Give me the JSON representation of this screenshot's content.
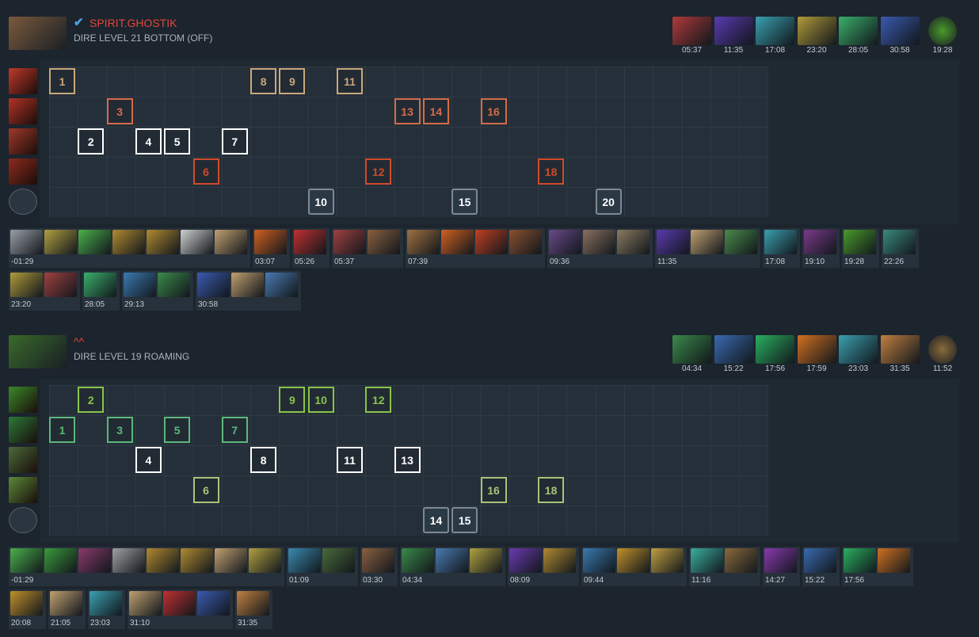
{
  "players": [
    {
      "verified": true,
      "name": "SPIRIT.GHOSTIK",
      "name_color": "#e0473a",
      "subtitle": "DIRE LEVEL 21 BOTTOM (OFF)",
      "portrait_color": "#7a5a3c",
      "final_items": [
        {
          "time": "05:37",
          "color": "#b03a3a"
        },
        {
          "time": "11:35",
          "color": "#5a3ab0"
        },
        {
          "time": "17:08",
          "color": "#3aa0b0"
        },
        {
          "time": "23:20",
          "color": "#b09a3a"
        },
        {
          "time": "28:05",
          "color": "#3ab06a"
        },
        {
          "time": "30:58",
          "color": "#3a5ab0"
        }
      ],
      "neutral": {
        "time": "19:28",
        "color": "#4a9a2a"
      },
      "skills": [
        {
          "name": "skill-1-icon",
          "color": "#c0392b",
          "row_color": "#c9a77a"
        },
        {
          "name": "skill-2-icon",
          "color": "#b33326",
          "row_color": "#d46b4a"
        },
        {
          "name": "skill-3-icon",
          "color": "#a0392b",
          "row_color": "#ffffff"
        },
        {
          "name": "skill-4-icon",
          "color": "#8e2b1e",
          "row_color": "#d04a2a"
        },
        {
          "name": "talent-icon",
          "color": "#2b3540",
          "row_color": "#7d8993"
        }
      ],
      "levels": [
        {
          "lv": "1",
          "row": 0,
          "col": 0
        },
        {
          "lv": "2",
          "row": 2,
          "col": 1
        },
        {
          "lv": "3",
          "row": 1,
          "col": 2
        },
        {
          "lv": "4",
          "row": 2,
          "col": 3
        },
        {
          "lv": "5",
          "row": 2,
          "col": 4
        },
        {
          "lv": "6",
          "row": 3,
          "col": 5
        },
        {
          "lv": "7",
          "row": 2,
          "col": 6
        },
        {
          "lv": "8",
          "row": 0,
          "col": 7
        },
        {
          "lv": "9",
          "row": 0,
          "col": 8
        },
        {
          "lv": "10",
          "row": 4,
          "col": 9
        },
        {
          "lv": "11",
          "row": 0,
          "col": 10
        },
        {
          "lv": "12",
          "row": 3,
          "col": 11
        },
        {
          "lv": "13",
          "row": 1,
          "col": 12
        },
        {
          "lv": "14",
          "row": 1,
          "col": 13
        },
        {
          "lv": "15",
          "row": 4,
          "col": 14
        },
        {
          "lv": "16",
          "row": 1,
          "col": 15
        },
        {
          "lv": "18",
          "row": 3,
          "col": 17
        },
        {
          "lv": "20",
          "row": 4,
          "col": 19
        }
      ],
      "timeline_rows": [
        [
          {
            "time": "-01:29",
            "icons": [
              "#9aa0a6",
              "#b0a040",
              "#4ab04a",
              "#b08a30",
              "#b08a30",
              "#d0d0d0",
              "#c0a070"
            ]
          },
          {
            "time": "03:07",
            "icons": [
              "#d06020"
            ]
          },
          {
            "time": "05:26",
            "icons": [
              "#c03030"
            ]
          },
          {
            "time": "05:37",
            "icons": [
              "#a04040",
              "#8a6040"
            ]
          },
          {
            "time": "07:39",
            "icons": [
              "#a07040",
              "#d06020",
              "#c04020",
              "#8a5030"
            ]
          },
          {
            "time": "09:36",
            "icons": [
              "#6a4a8a",
              "#8a7060",
              "#8a7a60"
            ]
          },
          {
            "time": "11:35",
            "icons": [
              "#5a3ab0",
              "#c0a070",
              "#4a8a4a"
            ]
          },
          {
            "time": "17:08",
            "icons": [
              "#3aa0b0"
            ]
          },
          {
            "time": "19:10",
            "icons": [
              "#7a3a8a"
            ]
          },
          {
            "time": "19:28",
            "icons": [
              "#4a9a2a"
            ]
          },
          {
            "time": "22:26",
            "icons": [
              "#3a8a7a"
            ]
          }
        ],
        [
          {
            "time": "23:20",
            "icons": [
              "#b09a3a",
              "#a04040"
            ]
          },
          {
            "time": "28:05",
            "icons": [
              "#3ab06a"
            ]
          },
          {
            "time": "29:13",
            "icons": [
              "#3a7ab0",
              "#3a8a4a"
            ]
          },
          {
            "time": "30:58",
            "icons": [
              "#3a5ab0",
              "#c0a070",
              "#4a7ab0"
            ]
          }
        ]
      ]
    },
    {
      "verified": false,
      "name": "^^",
      "name_color": "#e0473a",
      "subtitle": "DIRE LEVEL 19 ROAMING",
      "portrait_color": "#3a6a2a",
      "final_items": [
        {
          "time": "04:34",
          "color": "#3a8a4a"
        },
        {
          "time": "15:22",
          "color": "#3a6ab0"
        },
        {
          "time": "17:56",
          "color": "#2ab060"
        },
        {
          "time": "17:59",
          "color": "#d07020"
        },
        {
          "time": "23:03",
          "color": "#3aa0b0"
        },
        {
          "time": "31:35",
          "color": "#c08040"
        }
      ],
      "neutral": {
        "time": "11:52",
        "color": "#8a6a3a"
      },
      "skills": [
        {
          "name": "skill-1-icon",
          "color": "#3a8a2a",
          "row_color": "#8ac34a"
        },
        {
          "name": "skill-2-icon",
          "color": "#2a7a3a",
          "row_color": "#5ab87a"
        },
        {
          "name": "skill-3-icon",
          "color": "#4a6a3a",
          "row_color": "#ffffff"
        },
        {
          "name": "skill-4-icon",
          "color": "#5a8a3a",
          "row_color": "#a8c37a"
        },
        {
          "name": "talent-icon",
          "color": "#2b3540",
          "row_color": "#7d8993"
        }
      ],
      "levels": [
        {
          "lv": "1",
          "row": 1,
          "col": 0
        },
        {
          "lv": "2",
          "row": 0,
          "col": 1
        },
        {
          "lv": "3",
          "row": 1,
          "col": 2
        },
        {
          "lv": "4",
          "row": 2,
          "col": 3
        },
        {
          "lv": "5",
          "row": 1,
          "col": 4
        },
        {
          "lv": "6",
          "row": 3,
          "col": 5
        },
        {
          "lv": "7",
          "row": 1,
          "col": 6
        },
        {
          "lv": "8",
          "row": 2,
          "col": 7
        },
        {
          "lv": "9",
          "row": 0,
          "col": 8
        },
        {
          "lv": "10",
          "row": 0,
          "col": 9
        },
        {
          "lv": "11",
          "row": 2,
          "col": 10
        },
        {
          "lv": "12",
          "row": 0,
          "col": 11
        },
        {
          "lv": "13",
          "row": 2,
          "col": 12
        },
        {
          "lv": "14",
          "row": 4,
          "col": 13
        },
        {
          "lv": "15",
          "row": 4,
          "col": 14
        },
        {
          "lv": "16",
          "row": 3,
          "col": 15
        },
        {
          "lv": "18",
          "row": 3,
          "col": 17
        }
      ],
      "timeline_rows": [
        [
          {
            "time": "-01:29",
            "icons": [
              "#4ab04a",
              "#3a9a3a",
              "#8a3a6a",
              "#a0a0a0",
              "#b08a30",
              "#b08a30",
              "#c0a070",
              "#b0a040"
            ]
          },
          {
            "time": "01:09",
            "icons": [
              "#3a8ab0",
              "#4a6a3a"
            ]
          },
          {
            "time": "03:30",
            "icons": [
              "#8a6040"
            ]
          },
          {
            "time": "04:34",
            "icons": [
              "#3a8a4a",
              "#4a7ab0",
              "#b0a040"
            ]
          },
          {
            "time": "08:09",
            "icons": [
              "#6a3ab0",
              "#b08a30"
            ]
          },
          {
            "time": "09:44",
            "icons": [
              "#3a7ab0",
              "#c0902a",
              "#c0a040"
            ]
          },
          {
            "time": "11:16",
            "icons": [
              "#3ab0a0",
              "#8a6a3a"
            ]
          },
          {
            "time": "14:27",
            "icons": [
              "#8a3ab0"
            ]
          },
          {
            "time": "15:22",
            "icons": [
              "#3a6ab0"
            ]
          },
          {
            "time": "17:56",
            "icons": [
              "#2ab060",
              "#d07020"
            ]
          }
        ],
        [
          {
            "time": "20:08",
            "icons": [
              "#c0902a"
            ]
          },
          {
            "time": "21:05",
            "icons": [
              "#c0a070"
            ]
          },
          {
            "time": "23:03",
            "icons": [
              "#3aa0b0"
            ]
          },
          {
            "time": "31:10",
            "icons": [
              "#c0a070",
              "#c03030",
              "#3a5ab0"
            ]
          },
          {
            "time": "31:35",
            "icons": [
              "#c08040"
            ]
          }
        ]
      ]
    }
  ]
}
